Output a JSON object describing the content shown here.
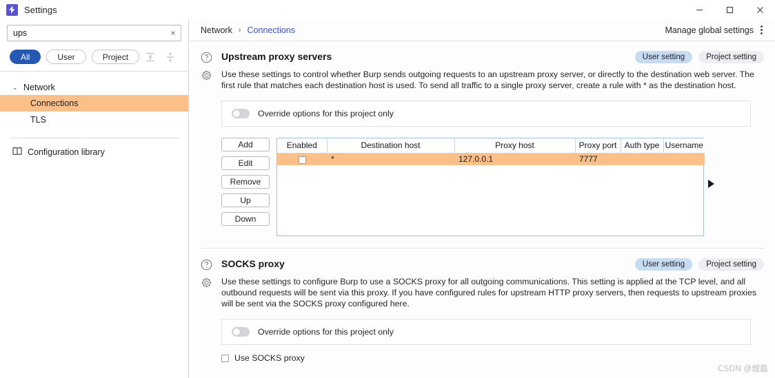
{
  "window": {
    "title": "Settings",
    "logo_icon": "burp-bolt-icon",
    "minimize_label": "minimize-icon",
    "maximize_label": "maximize-icon",
    "close_label": "close-icon"
  },
  "search": {
    "value": "ups",
    "placeholder": "Search",
    "clear_icon": "×"
  },
  "filters": [
    {
      "label": "All",
      "active": true
    },
    {
      "label": "User",
      "active": false
    },
    {
      "label": "Project",
      "active": false
    }
  ],
  "tree_tools": [
    {
      "name": "collapse-all-icon"
    },
    {
      "name": "expand-all-icon"
    }
  ],
  "sidebar": {
    "group": {
      "label": "Network",
      "chevron": "⌄"
    },
    "items": [
      {
        "label": "Connections",
        "selected": true
      },
      {
        "label": "TLS",
        "selected": false
      }
    ],
    "library": {
      "label": "Configuration library",
      "icon": "book-icon"
    }
  },
  "breadcrumb": {
    "parent": "Network",
    "separator": "›",
    "current": "Connections"
  },
  "manage": {
    "label": "Manage global settings",
    "icon": "kebab-menu-icon"
  },
  "sections": [
    {
      "id": "upstream",
      "title": "Upstream proxy servers",
      "help_icon": "question-circle-icon",
      "gear_icon": "gear-icon",
      "badges": [
        {
          "label": "User setting",
          "kind": "user"
        },
        {
          "label": "Project setting",
          "kind": "project"
        }
      ],
      "description": "Use these settings to  control whether Burp sends outgoing requests to an upstream proxy server, or directly to the destination web server. The first rule that matches each destination host is used. To send all traffic to a single proxy server, create a rule with * as the destination host.",
      "override": {
        "label": "Override options for this project only",
        "enabled": false
      },
      "buttons": [
        "Add",
        "Edit",
        "Remove",
        "Up",
        "Down"
      ],
      "table": {
        "columns": [
          "Enabled",
          "Destination host",
          "Proxy host",
          "Proxy port",
          "Auth type",
          "Username"
        ],
        "rows": [
          {
            "enabled": false,
            "destination_host": "*",
            "proxy_host": "127.0.0.1",
            "proxy_port": "7777",
            "auth_type": "",
            "username": "",
            "selected": true
          }
        ],
        "scroll_arrow_icon": "scroll-right-arrow-icon"
      }
    },
    {
      "id": "socks",
      "title": "SOCKS proxy",
      "help_icon": "question-circle-icon",
      "gear_icon": "gear-icon",
      "badges": [
        {
          "label": "User setting",
          "kind": "user"
        },
        {
          "label": "Project setting",
          "kind": "project"
        }
      ],
      "description": "Use these settings to configure Burp to use a SOCKS proxy for all outgoing communications. This setting is applied at the TCP level, and all outbound requests will be sent via this proxy. If you have configured rules for upstream HTTP proxy servers, then requests to upstream proxies will be sent via the SOCKS proxy configured here.",
      "override": {
        "label": "Override options for this project only",
        "enabled": false
      },
      "use_socks": {
        "label": "Use SOCKS proxy",
        "checked": false
      }
    }
  ],
  "watermark": "CSDN @煜磊",
  "colors": {
    "accent_blue": "#2458b3",
    "selection_orange": "#fbc08a",
    "link": "#3b4fc4",
    "badge_user": "#c7dbf2",
    "badge_project": "#eceef1"
  }
}
